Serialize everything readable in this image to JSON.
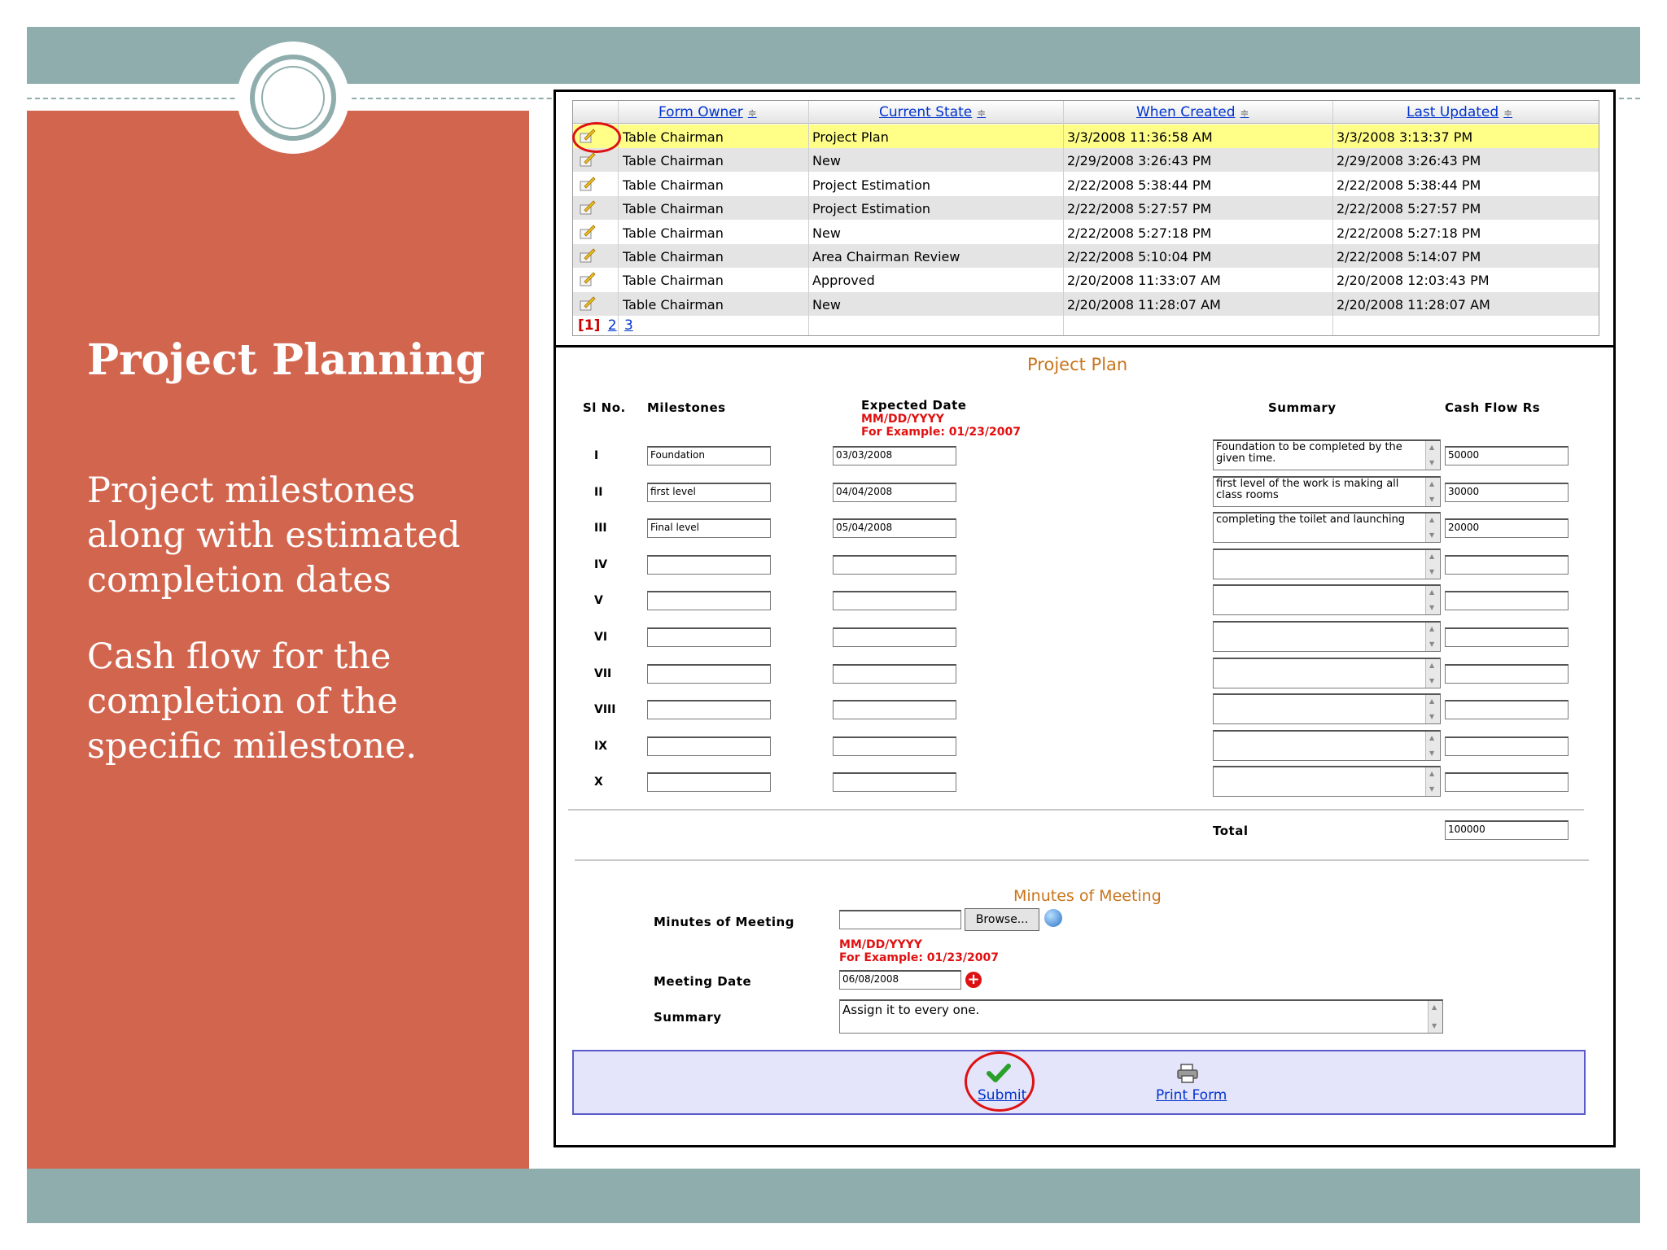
{
  "slide": {
    "title": "Project Planning",
    "bullets": [
      "Project milestones along with estimated completion dates",
      "Cash flow for the completion of the specific milestone."
    ]
  },
  "grid": {
    "columns": [
      "Form Owner",
      "Current State",
      "When Created",
      "Last Updated"
    ],
    "sort_glyph": "≑",
    "rows": [
      {
        "owner": "Table Chairman",
        "state": "Project Plan",
        "created": "3/3/2008 11:36:58 AM",
        "updated": "3/3/2008 3:13:37 PM",
        "selected": true
      },
      {
        "owner": "Table Chairman",
        "state": "New",
        "created": "2/29/2008 3:26:43 PM",
        "updated": "2/29/2008 3:26:43 PM"
      },
      {
        "owner": "Table Chairman",
        "state": "Project Estimation",
        "created": "2/22/2008 5:38:44 PM",
        "updated": "2/22/2008 5:38:44 PM"
      },
      {
        "owner": "Table Chairman",
        "state": "Project Estimation",
        "created": "2/22/2008 5:27:57 PM",
        "updated": "2/22/2008 5:27:57 PM"
      },
      {
        "owner": "Table Chairman",
        "state": "New",
        "created": "2/22/2008 5:27:18 PM",
        "updated": "2/22/2008 5:27:18 PM"
      },
      {
        "owner": "Table Chairman",
        "state": "Area Chairman Review",
        "created": "2/22/2008 5:10:04 PM",
        "updated": "2/22/2008 5:14:07 PM"
      },
      {
        "owner": "Table Chairman",
        "state": "Approved",
        "created": "2/20/2008 11:33:07 AM",
        "updated": "2/20/2008 12:03:43 PM"
      },
      {
        "owner": "Table Chairman",
        "state": "New",
        "created": "2/20/2008 11:28:07 AM",
        "updated": "2/20/2008 11:28:07 AM"
      }
    ],
    "pager": {
      "current": "[1]",
      "pages": [
        "2",
        "3"
      ]
    }
  },
  "project_plan": {
    "title": "Project Plan",
    "headers": {
      "sl_no": "Sl No.",
      "milestones": "Milestones",
      "expected_date": "Expected Date",
      "summary": "Summary",
      "cash_flow": "Cash Flow Rs"
    },
    "date_hint": {
      "format": "MM/DD/YYYY",
      "example": "For Example: 01/23/2007"
    },
    "rows": [
      {
        "no": "I",
        "milestone": "Foundation",
        "date": "03/03/2008",
        "summary": "Foundation to be completed by the given time.",
        "cash": "50000"
      },
      {
        "no": "II",
        "milestone": "first level",
        "date": "04/04/2008",
        "summary": "first level of the work is making all class rooms",
        "cash": "30000"
      },
      {
        "no": "III",
        "milestone": "Final level",
        "date": "05/04/2008",
        "summary": "completing the toilet and launching",
        "cash": "20000"
      },
      {
        "no": "IV",
        "milestone": "",
        "date": "",
        "summary": "",
        "cash": ""
      },
      {
        "no": "V",
        "milestone": "",
        "date": "",
        "summary": "",
        "cash": ""
      },
      {
        "no": "VI",
        "milestone": "",
        "date": "",
        "summary": "",
        "cash": ""
      },
      {
        "no": "VII",
        "milestone": "",
        "date": "",
        "summary": "",
        "cash": ""
      },
      {
        "no": "VIII",
        "milestone": "",
        "date": "",
        "summary": "",
        "cash": ""
      },
      {
        "no": "IX",
        "milestone": "",
        "date": "",
        "summary": "",
        "cash": ""
      },
      {
        "no": "X",
        "milestone": "",
        "date": "",
        "summary": "",
        "cash": ""
      }
    ],
    "total_label": "Total",
    "total_value": "100000"
  },
  "meeting": {
    "title": "Minutes of Meeting",
    "minutes_label": "Minutes of Meeting",
    "browse_label": "Browse...",
    "date_hint": {
      "format": "MM/DD/YYYY",
      "example": "For Example: 01/23/2007"
    },
    "date_label": "Meeting Date",
    "date_value": "06/08/2008",
    "summary_label": "Summary",
    "summary_value": "Assign it to every one."
  },
  "actions": {
    "submit_label": "Submit",
    "print_label": "Print Form"
  },
  "colors": {
    "band": "#8fadac",
    "panel": "#d2654e",
    "selected_row": "#ffff88",
    "link": "#0033cc",
    "hint_red": "#e01010",
    "form_title": "#c8741b"
  }
}
